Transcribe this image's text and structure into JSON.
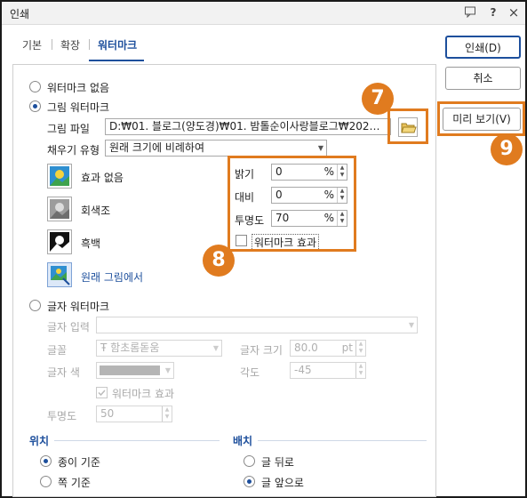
{
  "window": {
    "title": "인쇄",
    "help_glyph": "?",
    "close_glyph": "×"
  },
  "tabs": [
    {
      "label": "기본"
    },
    {
      "label": "확장"
    },
    {
      "label": "워터마크"
    }
  ],
  "watermark": {
    "none_label": "워터마크 없음",
    "image_label": "그림 워터마크",
    "image_file_label": "그림 파일",
    "image_file_value": "D:₩01. 블로그(양도경)₩01. 밤톨순이사랑블로그₩202…",
    "fill_type_label": "채우기 유형",
    "fill_type_value": "원래 크기에 비례하여",
    "effects": [
      {
        "label": "효과 없음"
      },
      {
        "label": "회색조"
      },
      {
        "label": "흑백"
      },
      {
        "label": "원래 그림에서"
      }
    ],
    "brightness_label": "밝기",
    "brightness_value": "0",
    "contrast_label": "대비",
    "contrast_value": "0",
    "transparency_label": "투명도",
    "transparency_value": "70",
    "percent": "%",
    "effect_checkbox_label": "워터마크 효과",
    "text_label": "글자 워터마크",
    "text_input_label": "글자 입력",
    "font_label": "글꼴",
    "font_value": "함초롬돋움",
    "font_size_label": "글자 크기",
    "font_size_value": "80.0",
    "font_size_unit": "pt",
    "text_color_label": "글자 색",
    "angle_label": "각도",
    "angle_value": "-45",
    "text_effect_label": "워터마크 효과",
    "text_transparency_label": "투명도",
    "text_transparency_value": "50"
  },
  "position": {
    "title": "위치",
    "paper_label": "종이 기준",
    "page_label": "쪽 기준"
  },
  "layout": {
    "title": "배치",
    "behind_label": "글 뒤로",
    "front_label": "글 앞으로"
  },
  "buttons": {
    "print": "인쇄(D)",
    "cancel": "취소",
    "preview": "미리 보기(V)"
  },
  "callouts": {
    "seven": "7",
    "eight": "8",
    "nine": "9"
  },
  "colors": {
    "accent": "#1d4f9c",
    "callout": "#e07b1f"
  }
}
